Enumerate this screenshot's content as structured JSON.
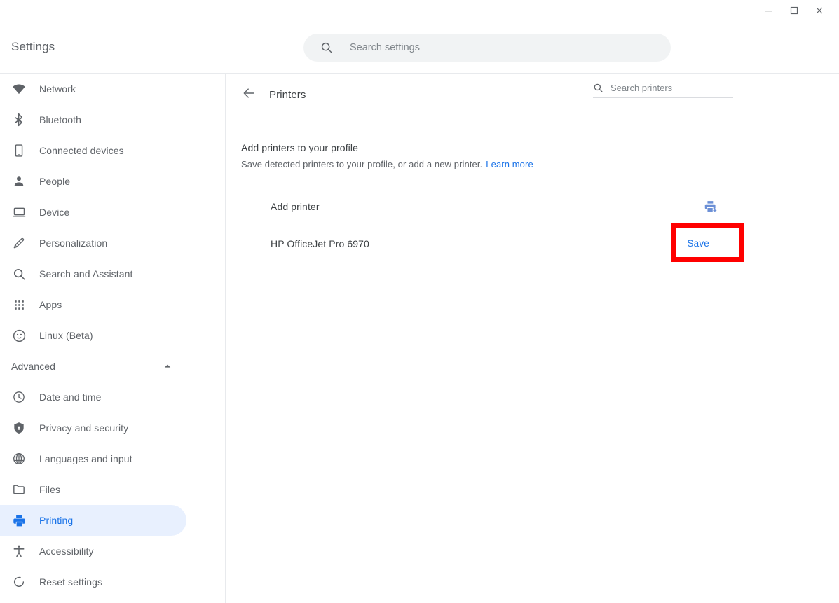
{
  "window": {
    "controls": [
      {
        "name": "minimize",
        "glyph": "minimize-icon"
      },
      {
        "name": "maximize",
        "glyph": "maximize-icon"
      },
      {
        "name": "close",
        "glyph": "close-icon"
      }
    ]
  },
  "header": {
    "brand": "Settings",
    "search": {
      "placeholder": "Search settings",
      "value": "",
      "icon": "search-icon"
    }
  },
  "sidebar": {
    "items": [
      {
        "label": "Network",
        "icon": "wifi-icon",
        "selected": false
      },
      {
        "label": "Bluetooth",
        "icon": "bluetooth-icon",
        "selected": false
      },
      {
        "label": "Connected devices",
        "icon": "phone-icon",
        "selected": false
      },
      {
        "label": "People",
        "icon": "person-icon",
        "selected": false
      },
      {
        "label": "Device",
        "icon": "laptop-icon",
        "selected": false
      },
      {
        "label": "Personalization",
        "icon": "pencil-icon",
        "selected": false
      },
      {
        "label": "Search and Assistant",
        "icon": "search-icon",
        "selected": false
      },
      {
        "label": "Apps",
        "icon": "grid-apps-icon",
        "selected": false
      },
      {
        "label": "Linux (Beta)",
        "icon": "linux-penguin-icon",
        "selected": false
      }
    ],
    "advanced": {
      "label": "Advanced",
      "expanded": true,
      "chevron": "chevron-up-icon"
    },
    "advanced_items": [
      {
        "label": "Date and time",
        "icon": "clock-icon",
        "selected": false
      },
      {
        "label": "Privacy and security",
        "icon": "shield-icon",
        "selected": false
      },
      {
        "label": "Languages and input",
        "icon": "globe-icon",
        "selected": false
      },
      {
        "label": "Files",
        "icon": "folder-icon",
        "selected": false
      },
      {
        "label": "Printing",
        "icon": "printer-icon",
        "selected": true
      },
      {
        "label": "Accessibility",
        "icon": "accessibility-icon",
        "selected": false
      },
      {
        "label": "Reset settings",
        "icon": "restore-icon",
        "selected": false
      }
    ]
  },
  "main": {
    "back_icon": "arrow-back-icon",
    "title": "Printers",
    "printer_search": {
      "placeholder": "Search printers",
      "value": "",
      "icon": "search-icon"
    },
    "section": {
      "title": "Add printers to your profile",
      "description": "Save detected printers to your profile, or add a new printer.",
      "learn_more": "Learn more"
    },
    "rows": [
      {
        "name": "Add printer",
        "action_type": "icon",
        "action_icon": "printer-add-icon",
        "action_label": ""
      },
      {
        "name": "HP OfficeJet Pro 6970",
        "action_type": "button",
        "action_icon": "",
        "action_label": "Save"
      }
    ]
  },
  "annotation": {
    "highlight_color": "#ff0000",
    "target": "Save"
  },
  "colors": {
    "accent": "#1a73e8",
    "selected_bg": "#e8f0fe",
    "text_primary": "#3c4043",
    "text_secondary": "#5f6368",
    "search_bg": "#f1f3f4"
  }
}
